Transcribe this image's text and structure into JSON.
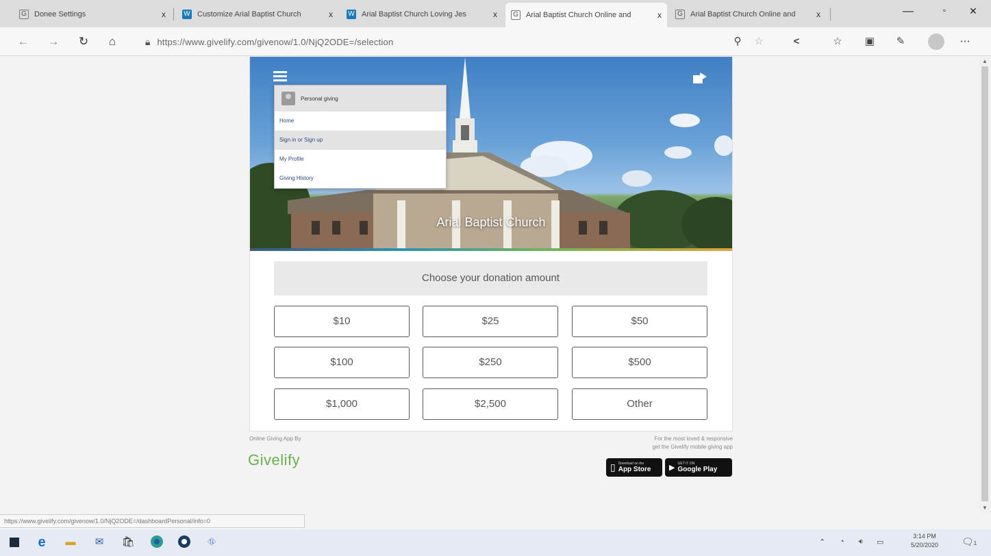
{
  "browser": {
    "tabs": [
      {
        "label": "Donee Settings",
        "icon": "givelify-favicon"
      },
      {
        "label": "Customize Arial Baptist Church",
        "icon": "wordpress-favicon"
      },
      {
        "label": "Arial Baptist Church Loving Jes",
        "icon": "wordpress-favicon"
      },
      {
        "label": "Arial Baptist Church Online and",
        "icon": "givelify-favicon"
      },
      {
        "label": "Arial Baptist Church Online and",
        "icon": "givelify-favicon"
      }
    ],
    "active_tab": 3,
    "tab_close": "x",
    "url": "https://www.givelify.com/givenow/1.0/NjQ2ODE=/selection",
    "window_controls": {
      "minimize": "—",
      "restore": "▫",
      "close": "✕"
    }
  },
  "page": {
    "church_name": "Arial Baptist Church",
    "menu": {
      "header": "Personal giving",
      "items": [
        "Home",
        "Sign in or Sign up",
        "My Profile",
        "Giving History"
      ],
      "highlighted": 1
    },
    "prompt": "Choose your donation amount",
    "amounts": [
      "$10",
      "$25",
      "$50",
      "$100",
      "$250",
      "$500",
      "$1,000",
      "$2,500",
      "Other"
    ],
    "footer": {
      "powered_by": "Online Giving App By",
      "logo": "Givelify",
      "mobile_note_1": "For the most loved & responsive",
      "mobile_note_2": "get the Givelify mobile giving app",
      "app_store_small": "Download on the",
      "app_store_big": "App Store",
      "google_play_small": "GET IT ON",
      "google_play_big": "Google Play"
    }
  },
  "status_url": "https://www.givelify.com/givenow/1.0/NjQ2ODE=/dashboardPersonal/info=0",
  "taskbar": {
    "time": "3:14 PM",
    "date": "5/20/2020",
    "notification_count": "1"
  },
  "colors": {
    "givelify_green": "#6ab04c",
    "menu_link": "#2e4a7c",
    "taskbar_bg": "#e6eaf2"
  }
}
